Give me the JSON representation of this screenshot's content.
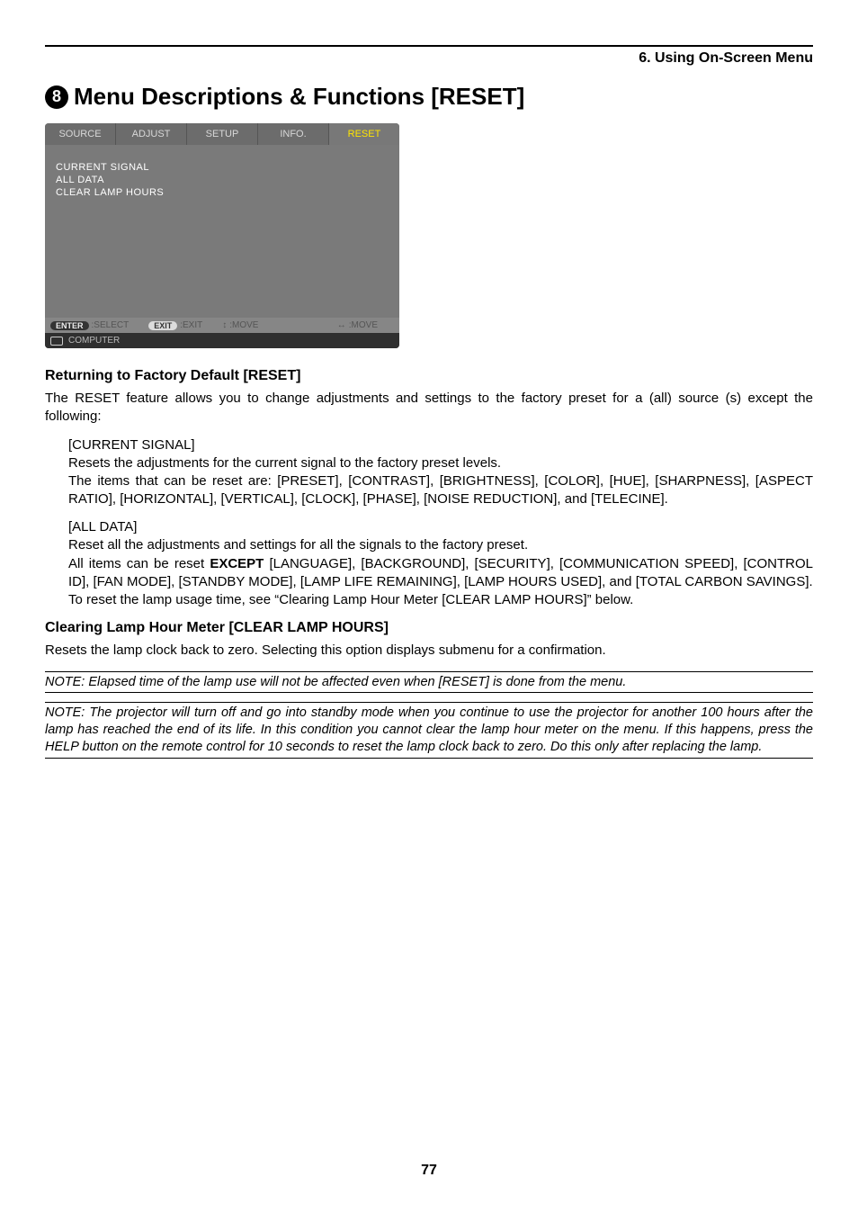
{
  "header": {
    "chapter": "6. Using On-Screen Menu"
  },
  "title": {
    "number": "8",
    "text": "Menu Descriptions & Functions [RESET]"
  },
  "menu": {
    "tabs": [
      "SOURCE",
      "ADJUST",
      "SETUP",
      "INFO.",
      "RESET"
    ],
    "active_index": 4,
    "items": [
      "CURRENT SIGNAL",
      "ALL DATA",
      "CLEAR LAMP HOURS"
    ],
    "legend": {
      "enter_badge": "ENTER",
      "enter_label": ":SELECT",
      "exit_badge": "EXIT",
      "exit_label": ":EXIT",
      "updown_symbol": "↕",
      "updown_label": ":MOVE",
      "leftright_symbol": "↔",
      "leftright_label": ":MOVE"
    },
    "source_line": "COMPUTER"
  },
  "section1": {
    "heading": "Returning to Factory Default [RESET]",
    "intro": "The RESET feature allows you to change adjustments and settings to the factory preset for a (all) source (s) except the following:",
    "cs_head": "[CURRENT SIGNAL]",
    "cs_l1": "Resets the adjustments for the current signal to the factory preset levels.",
    "cs_l2": "The items that can be reset are: [PRESET], [CONTRAST], [BRIGHTNESS], [COLOR], [HUE], [SHARPNESS], [ASPECT RATIO], [HORIZONTAL], [VERTICAL], [CLOCK], [PHASE], [NOISE REDUCTION], and [TELECINE].",
    "ad_head": "[ALL DATA]",
    "ad_l1": "Reset all the adjustments and settings for all the signals to the factory preset.",
    "ad_l2a": "All items can be reset ",
    "ad_l2_bold": "EXCEPT",
    "ad_l2b": " [LANGUAGE], [BACKGROUND], [SECURITY], [COMMUNICATION SPEED], [CONTROL ID], [FAN MODE], [STANDBY MODE], [LAMP LIFE REMAINING], [LAMP HOURS USED], and [TOTAL CARBON SAVINGS].",
    "ad_l3": "To reset the lamp usage time, see “Clearing Lamp Hour Meter [CLEAR LAMP HOURS]” below."
  },
  "section2": {
    "heading": "Clearing Lamp Hour Meter [CLEAR LAMP HOURS]",
    "p": "Resets the lamp clock back to zero. Selecting this option displays submenu for a confirmation."
  },
  "notes": {
    "n1": "NOTE: Elapsed time of the lamp use will not be affected even when [RESET] is done from the menu.",
    "n2": "NOTE: The projector will turn off and go into standby mode when you continue to use the projector for another 100 hours after the lamp has reached the end of its life. In this condition you cannot clear the lamp hour meter on the menu. If this happens, press the HELP button on the remote control for 10 seconds to reset the lamp clock back to zero. Do this only after replacing the lamp."
  },
  "page_number": "77"
}
